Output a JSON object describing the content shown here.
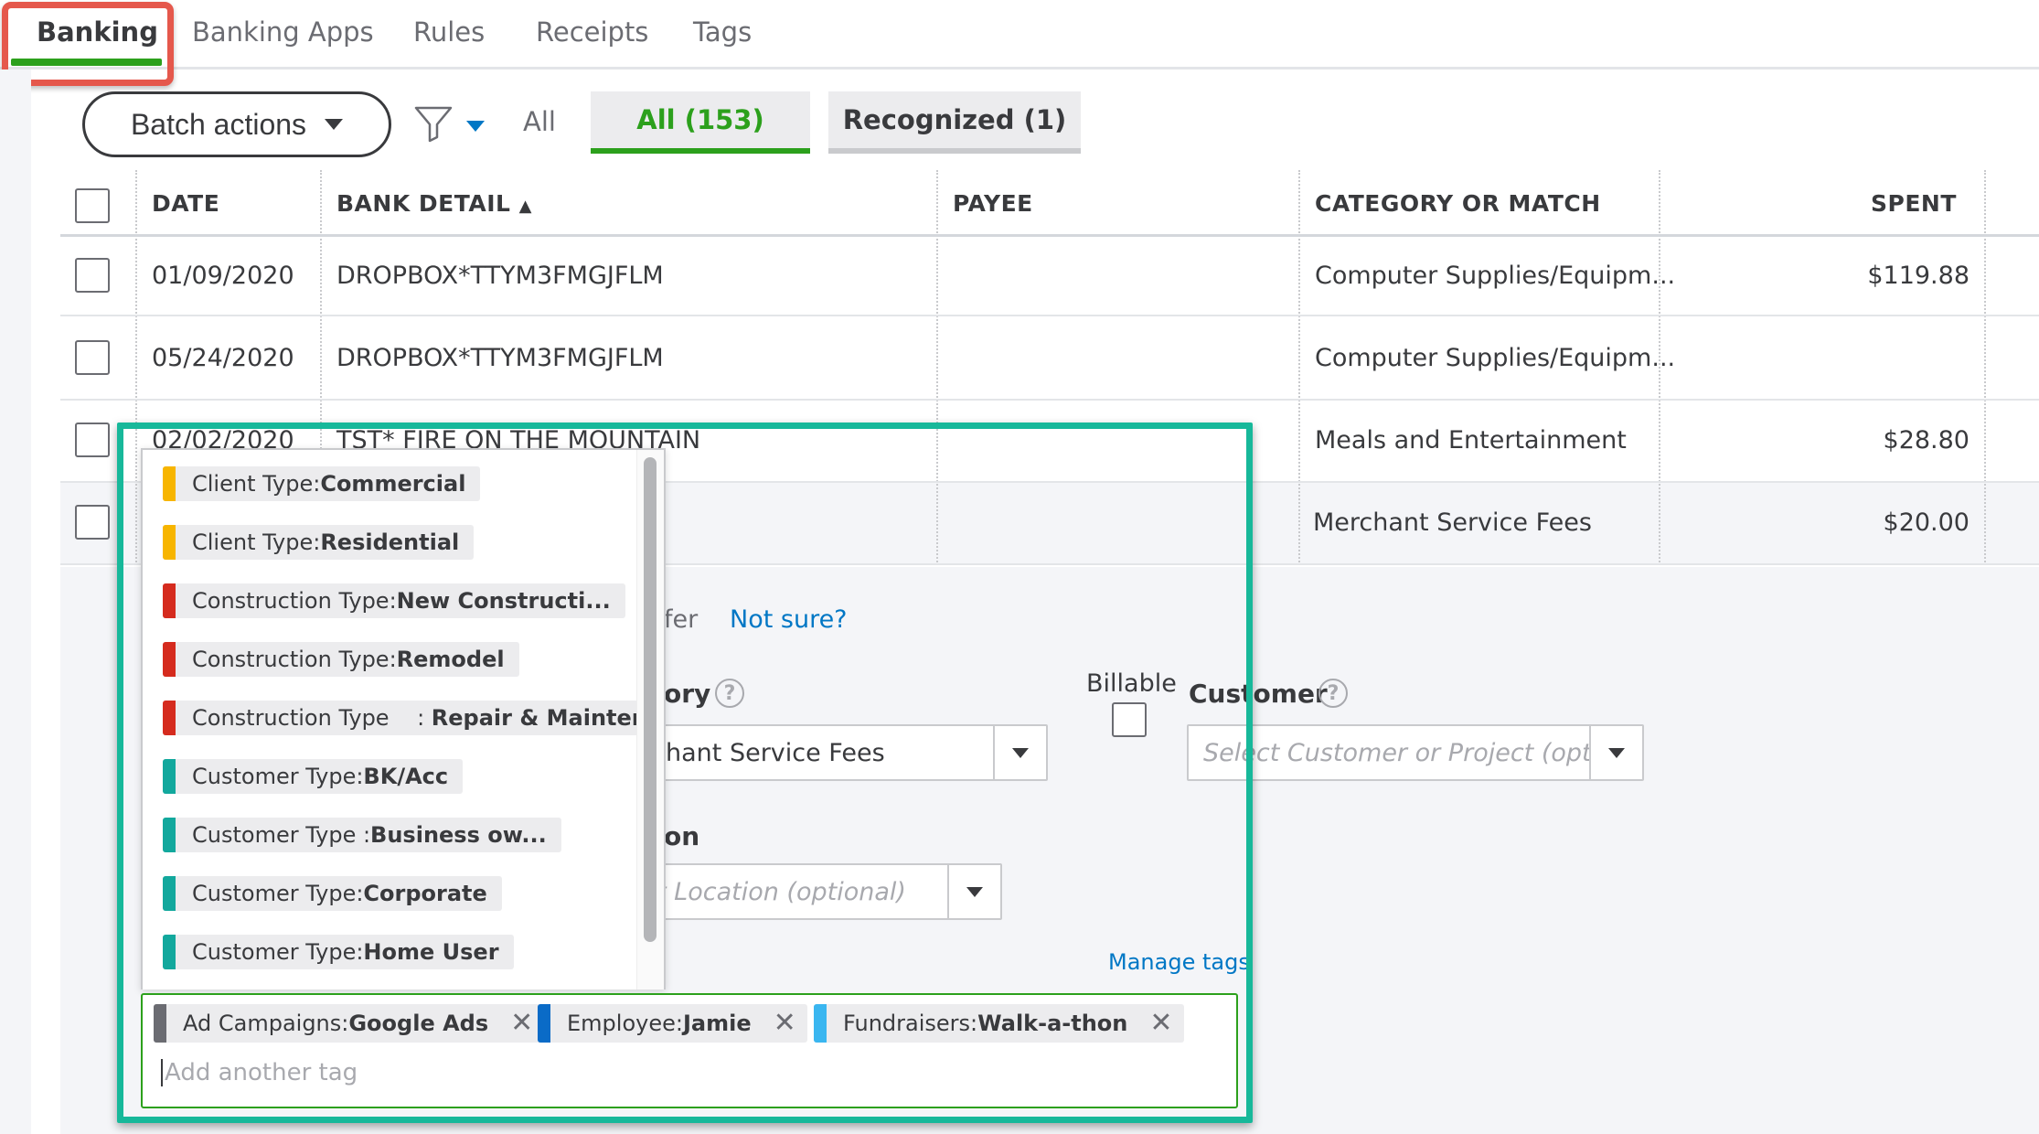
{
  "tabs": [
    {
      "label": "Banking",
      "active": true
    },
    {
      "label": "Banking Apps"
    },
    {
      "label": "Rules"
    },
    {
      "label": "Receipts"
    },
    {
      "label": "Tags"
    }
  ],
  "toolbar": {
    "batch_label": "Batch actions",
    "all_label": "All",
    "segments": [
      {
        "label": "All (153)",
        "active": true
      },
      {
        "label": "Recognized (1)"
      }
    ]
  },
  "table": {
    "headers": [
      "DATE",
      "BANK DETAIL",
      "PAYEE",
      "CATEGORY OR MATCH",
      "SPENT"
    ],
    "rows": [
      {
        "date": "01/09/2020",
        "detail": "DROPBOX*TTYM3FMGJFLM",
        "payee": "",
        "category": "Computer Supplies/Equipm...",
        "spent": "$119.88"
      },
      {
        "date": "05/24/2020",
        "detail": "DROPBOX*TTYM3FMGJFLM",
        "payee": "",
        "category": "Computer Supplies/Equipm...",
        "spent": ""
      },
      {
        "date": "02/02/2020",
        "detail": "TST* FIRE ON THE MOUNTAIN",
        "payee": "",
        "category": "Meals and Entertainment",
        "spent": "$28.80"
      },
      {
        "date": "",
        "detail": "",
        "payee": "",
        "category": "Merchant Service Fees",
        "spent": "$20.00"
      }
    ]
  },
  "detail": {
    "transfer_partial": "fer",
    "not_sure": "Not sure?",
    "category_partial": "ory",
    "category_value_partial": "hant Service Fees",
    "billable_label": "Billable",
    "customer_label": "Customer",
    "customer_placeholder": "Select Customer or Project (optional)",
    "location_partial": "on",
    "location_placeholder_partial": "t Location (optional)",
    "manage_tags": "Manage tags"
  },
  "tag_options": [
    {
      "group": "Client Type: ",
      "name": "Commercial",
      "color": "#f7b500"
    },
    {
      "group": "Client Type: ",
      "name": "Residential",
      "color": "#f7b500"
    },
    {
      "group": "Construction Type: ",
      "name": "New Constructi...",
      "color": "#d52b1e"
    },
    {
      "group": "Construction Type: ",
      "name": "Remodel",
      "color": "#d52b1e"
    },
    {
      "group": "Construction Type    : ",
      "name": "Repair & Mainten...",
      "color": "#d52b1e"
    },
    {
      "group": "Customer Type: ",
      "name": "BK/Acc",
      "color": "#12a89d"
    },
    {
      "group": "Customer Type : ",
      "name": "Business ow...",
      "color": "#12a89d"
    },
    {
      "group": "Customer Type: ",
      "name": "Corporate",
      "color": "#12a89d"
    },
    {
      "group": "Customer Type: ",
      "name": "Home User",
      "color": "#12a89d"
    }
  ],
  "selected_tags": [
    {
      "group": "Ad Campaigns: ",
      "name": "Google Ads",
      "color": "#6b6c72"
    },
    {
      "group": "Employee: ",
      "name": "Jamie",
      "color": "#0a6bc7"
    },
    {
      "group": "Fundraisers: ",
      "name": "Walk-a-thon",
      "color": "#3ab6f0"
    }
  ],
  "tag_input_placeholder": "Add another tag",
  "icons": {
    "filter": "filter-funnel-icon",
    "remove": "close-x-icon",
    "help": "question-circle-icon",
    "sort": "sort-up-icon"
  },
  "colors": {
    "accent_green": "#2ca01c",
    "link_blue": "#0077c5",
    "highlight_red": "#e5584c",
    "highlight_teal": "#17b89a"
  }
}
